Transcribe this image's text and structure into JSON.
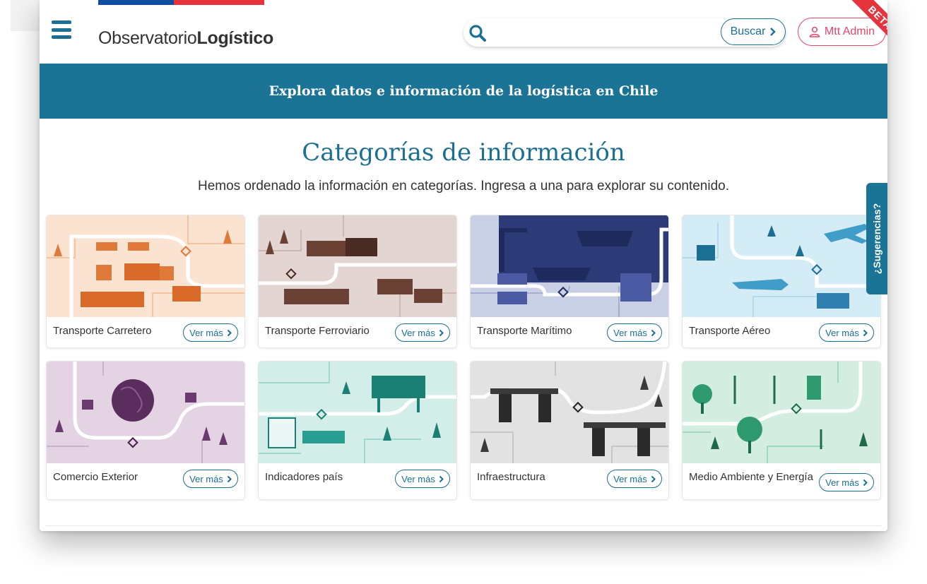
{
  "header": {
    "brand_light": "Observatorio",
    "brand_bold": "Logístico",
    "search_placeholder": "",
    "search_button": "Buscar",
    "user_button": "Mtt Admin",
    "ribbon": "BETA"
  },
  "banner": {
    "text": "Explora datos e información de la logística en Chile"
  },
  "section": {
    "title": "Categorías de información",
    "subtitle": "Hemos ordenado la información en categorías. Ingresa a una para explorar su contenido."
  },
  "cards": [
    {
      "label": "Transporte Carretero",
      "button": "Ver más",
      "bg": "#fbe3d2",
      "accent": "#e07a3a"
    },
    {
      "label": "Transporte Ferroviario",
      "button": "Ver más",
      "bg": "#e3d6d2",
      "accent": "#6b4136"
    },
    {
      "label": "Transporte Marítimo",
      "button": "Ver más",
      "bg": "#c9d0e6",
      "accent": "#3b4a8c"
    },
    {
      "label": "Transporte Aéreo",
      "button": "Ver más",
      "bg": "#d4ecf6",
      "accent": "#3f9dc8"
    },
    {
      "label": "Comercio Exterior",
      "button": "Ver más",
      "bg": "#e4d3e3",
      "accent": "#6b3a6e"
    },
    {
      "label": "Indicadores país",
      "button": "Ver más",
      "bg": "#d3ede9",
      "accent": "#2a9d91"
    },
    {
      "label": "Infraestructura",
      "button": "Ver más",
      "bg": "#e2e2e2",
      "accent": "#3a3a3a"
    },
    {
      "label": "Medio Ambiente y Energía",
      "button": "Ver más",
      "bg": "#d3ede0",
      "accent": "#2f9a6d"
    }
  ],
  "side_tab": {
    "text": "¿Sugerencias?"
  }
}
